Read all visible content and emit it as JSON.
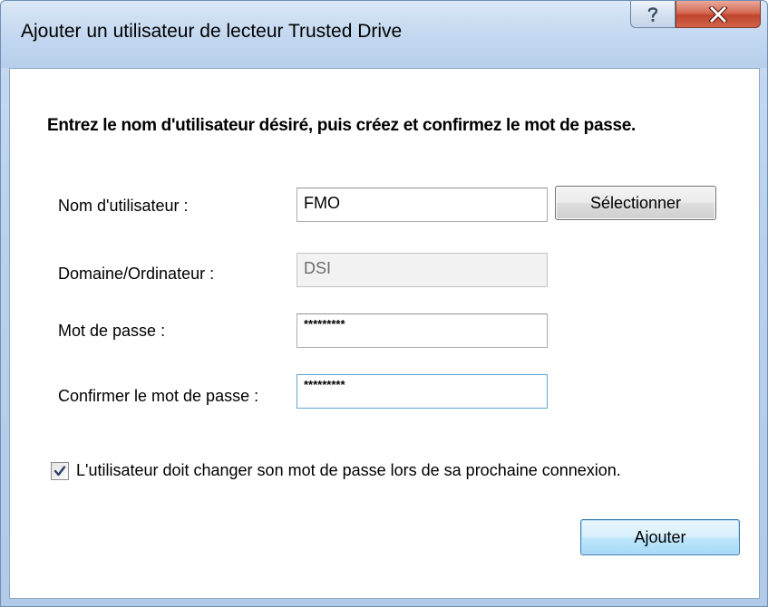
{
  "window": {
    "title": "Ajouter un utilisateur de lecteur Trusted Drive"
  },
  "instruction": "Entrez le nom d'utilisateur désiré, puis créez et confirmez le mot de passe.",
  "form": {
    "username": {
      "label": "Nom d'utilisateur :",
      "value": "FMO"
    },
    "select_button": "Sélectionner",
    "domain": {
      "label": "Domaine/Ordinateur :",
      "value": "DSI"
    },
    "password": {
      "label": "Mot de passe :",
      "value": "*********"
    },
    "confirm": {
      "label": "Confirmer le mot de passe :",
      "value": "*********"
    },
    "must_change": {
      "checked": true,
      "label": "L'utilisateur doit changer son mot de passe lors de sa prochaine connexion."
    },
    "add_button": "Ajouter"
  },
  "icons": {
    "help": "help-icon",
    "close": "close-icon",
    "check": "checkmark-icon"
  },
  "colors": {
    "title_bar": "#c4d8f0",
    "close_button": "#c0452c",
    "focus_border": "#5ea7d9",
    "default_button": "#3c7fb1"
  }
}
